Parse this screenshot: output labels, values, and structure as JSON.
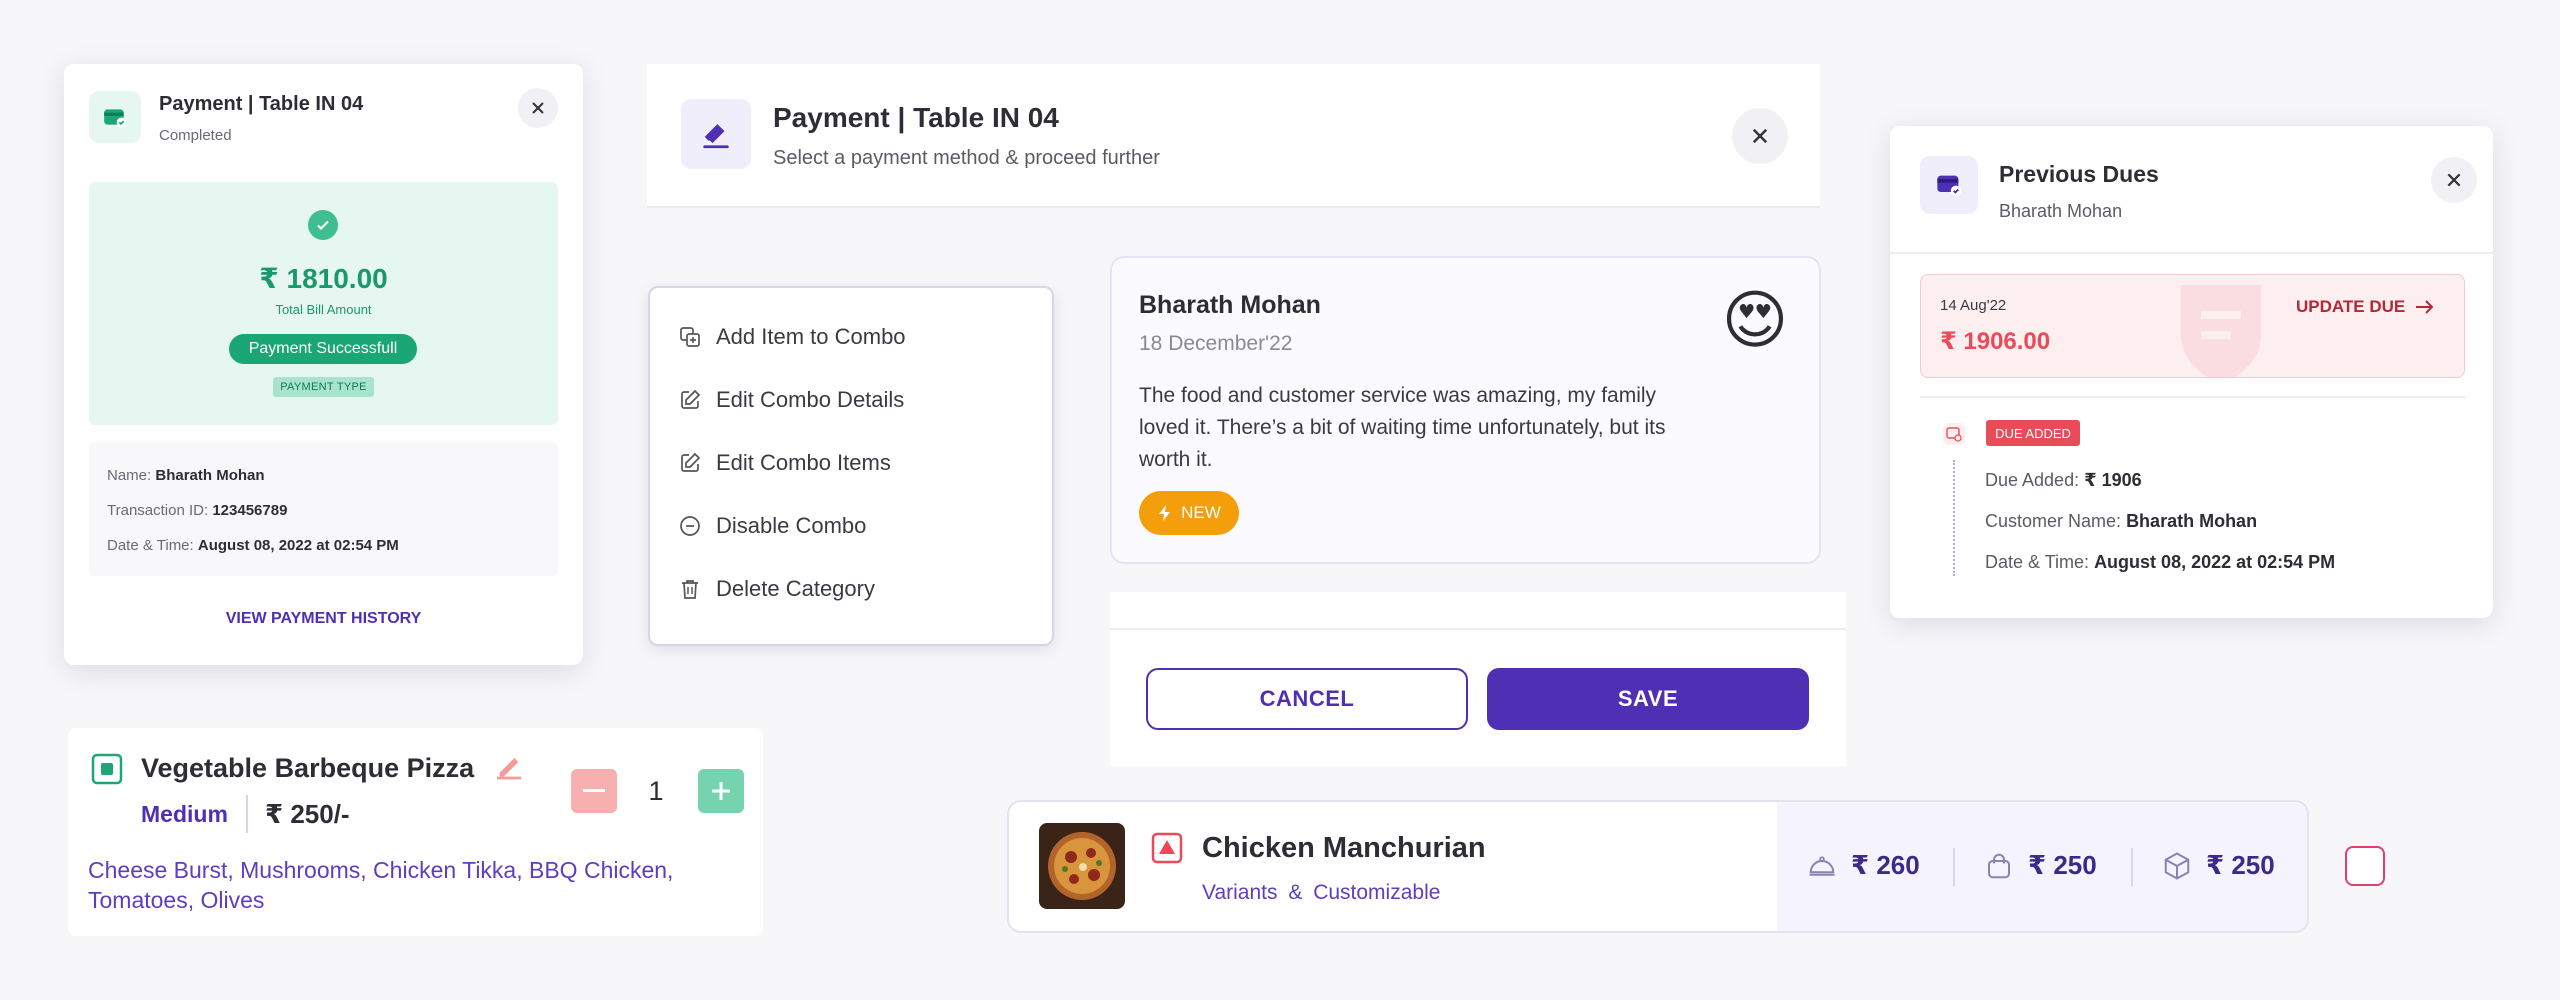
{
  "colors": {
    "primary": "#4f2fb3",
    "success": "#1aa775",
    "danger": "#e94b58",
    "warning": "#f59e0b"
  },
  "payment_card": {
    "title": "Payment | Table IN 04",
    "status": "Completed",
    "amount": "₹ 1810.00",
    "amount_label": "Total Bill Amount",
    "success_label": "Payment Successfull",
    "payment_type": "PAYMENT TYPE",
    "name_label": "Name:",
    "name": "Bharath Mohan",
    "txn_label": "Transaction ID:",
    "txn": "123456789",
    "date_label": "Date & Time:",
    "date": "August 08, 2022 at 02:54 PM",
    "history_link": "VIEW PAYMENT HISTORY"
  },
  "payment_header": {
    "title": "Payment | Table IN 04",
    "subtitle": "Select a payment method & proceed further"
  },
  "context_menu": {
    "items": [
      {
        "label": "Add Item to Combo",
        "icon": "add-combo-icon"
      },
      {
        "label": "Edit Combo Details",
        "icon": "edit-icon"
      },
      {
        "label": "Edit Combo Items",
        "icon": "edit-icon"
      },
      {
        "label": "Disable Combo",
        "icon": "disable-icon"
      },
      {
        "label": "Delete Category",
        "icon": "trash-icon"
      }
    ]
  },
  "review": {
    "name": "Bharath Mohan",
    "date": "18 December'22",
    "text": "The food and customer service was amazing, my family loved it. There’s a bit of waiting time unfortunately, but its worth it.",
    "badge": "NEW",
    "emoji": "😍"
  },
  "actions": {
    "cancel": "CANCEL",
    "save": "SAVE"
  },
  "dues": {
    "title": "Previous Dues",
    "subtitle": "Bharath Mohan",
    "due_date": "14 Aug'22",
    "due_amount": "₹ 1906.00",
    "update_label": "UPDATE DUE",
    "due_added_badge": "DUE ADDED",
    "due_added_label": "Due Added:",
    "due_added_value": "₹ 1906",
    "customer_label": "Customer Name:",
    "customer_value": "Bharath Mohan",
    "date_label": "Date & Time:",
    "date_value": "August 08, 2022 at 02:54 PM"
  },
  "pizza": {
    "name": "Vegetable Barbeque Pizza",
    "size": "Medium",
    "price": "₹ 250/-",
    "qty": "1",
    "toppings": "Cheese Burst, Mushrooms, Chicken Tikka, BBQ Chicken, Tomatoes, Olives"
  },
  "manchurian": {
    "name": "Chicken Manchurian",
    "variants": "Variants",
    "amp": "&",
    "customizable": "Customizable",
    "prices": [
      "₹ 260",
      "₹ 250",
      "₹ 250"
    ]
  }
}
